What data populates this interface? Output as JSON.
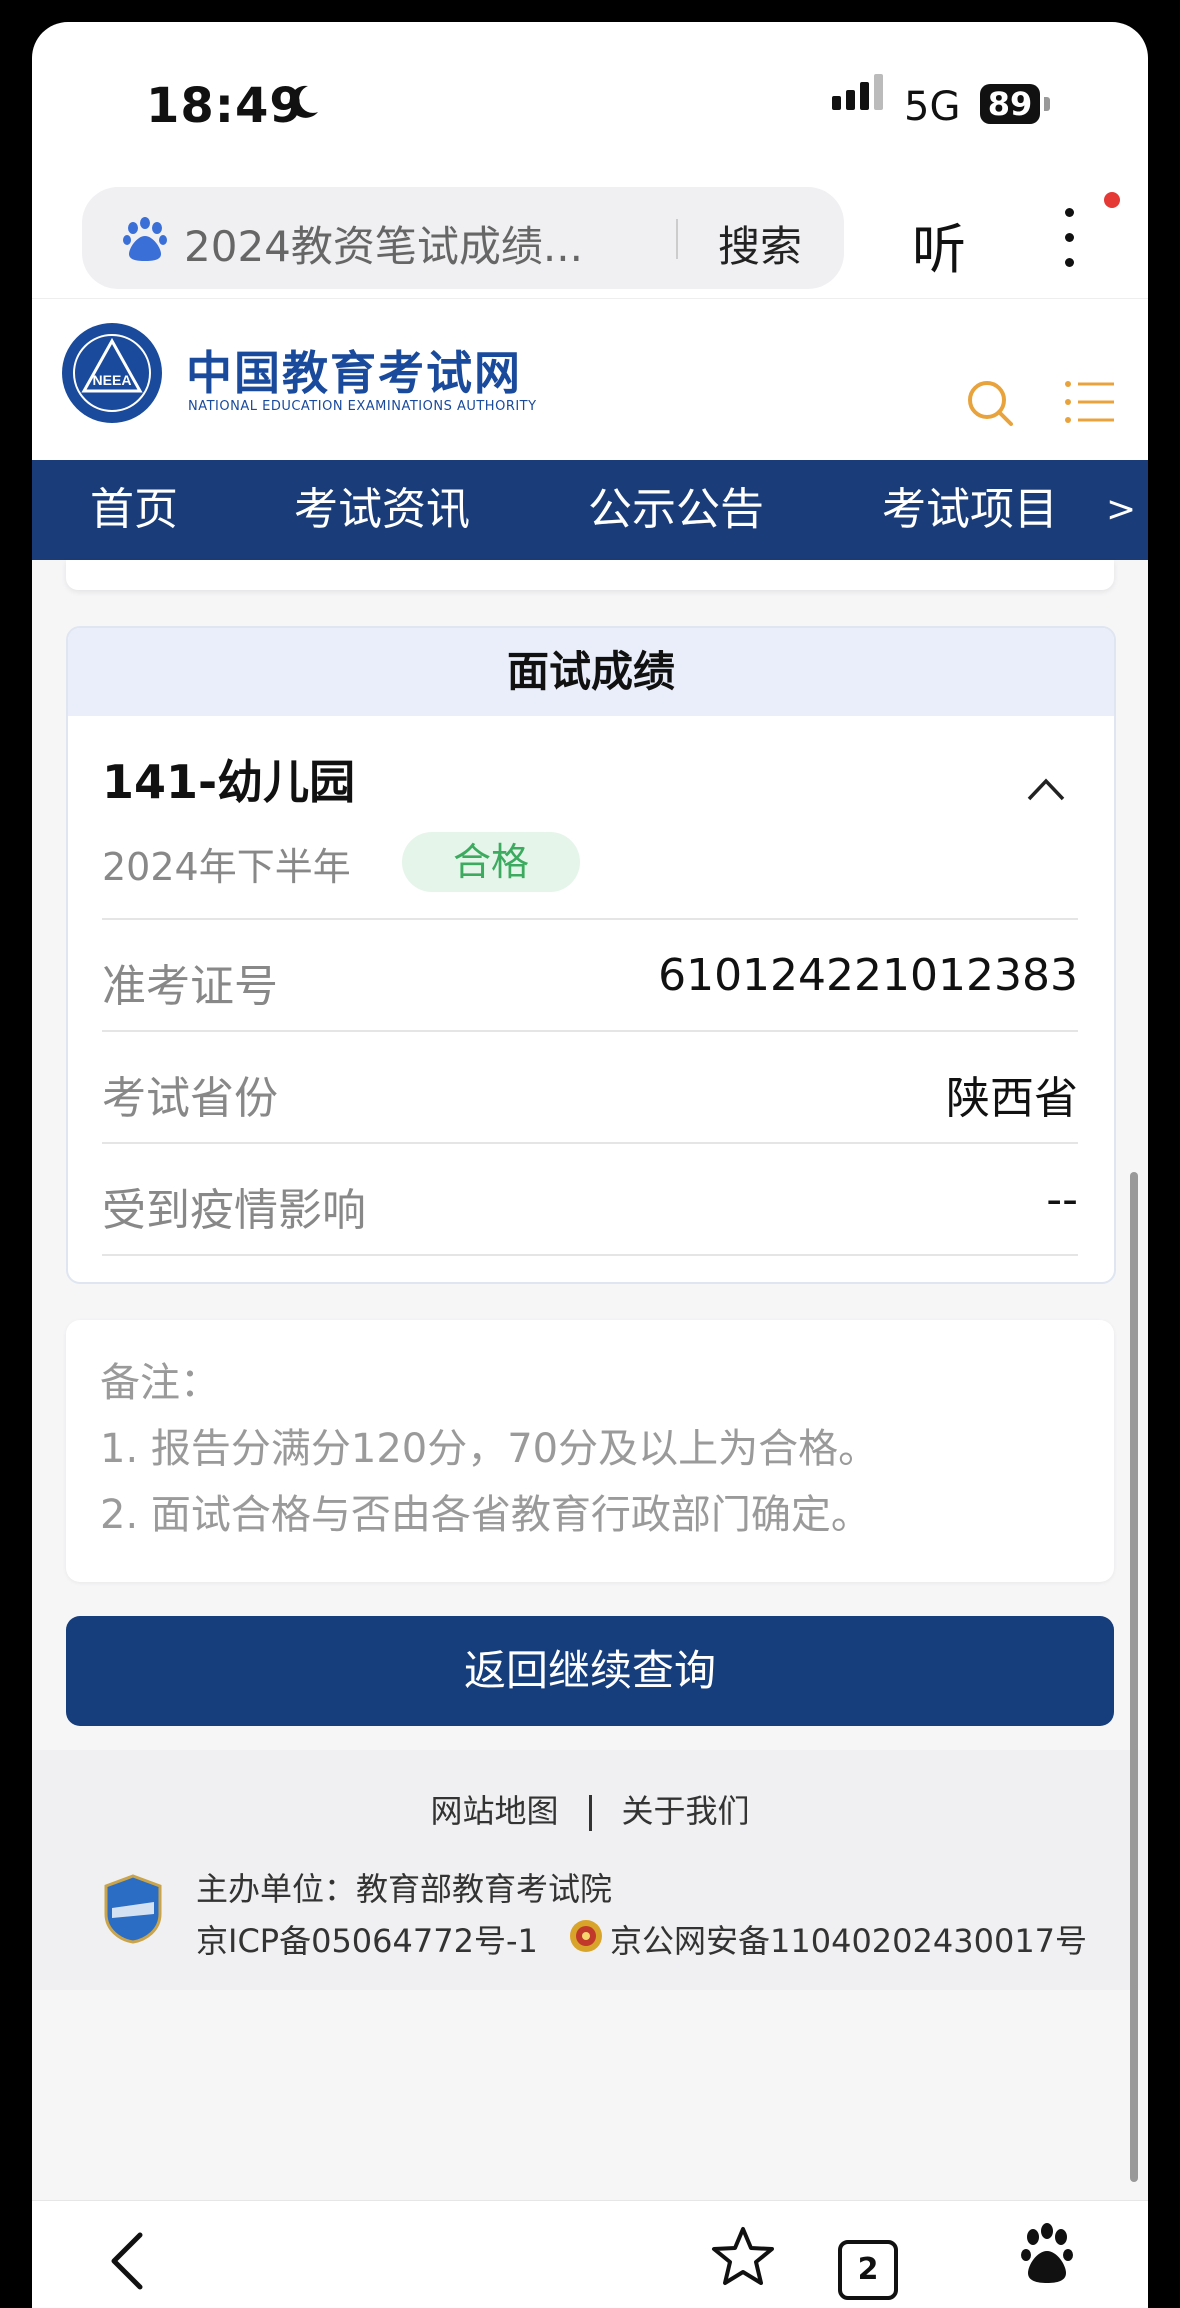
{
  "status_bar": {
    "time": "18:49",
    "network": "5G",
    "battery": "89"
  },
  "browser": {
    "search_text": "2024教资笔试成绩...",
    "search_button": "搜索",
    "listen_button": "听"
  },
  "site": {
    "title": "中国教育考试网",
    "subtitle": "NATIONAL EDUCATION EXAMINATIONS AUTHORITY",
    "logo_text": "NEEA"
  },
  "nav": {
    "items": [
      "首页",
      "考试资讯",
      "公示公告",
      "考试项目"
    ],
    "more": ">"
  },
  "result_card": {
    "title": "面试成绩",
    "subject": "141-幼儿园",
    "semester": "2024年下半年",
    "status": "合格",
    "rows": [
      {
        "label": "准考证号",
        "value": "610124221012383"
      },
      {
        "label": "考试省份",
        "value": "陕西省"
      },
      {
        "label": "受到疫情影响",
        "value": "--"
      }
    ]
  },
  "notes": {
    "title": "备注：",
    "lines": [
      "1. 报告分满分120分，70分及以上为合格。",
      "2. 面试合格与否由各省教育行政部门确定。"
    ]
  },
  "back_button": "返回继续查询",
  "footer": {
    "links": [
      "网站地图",
      "关于我们"
    ],
    "host": "主办单位：教育部教育考试院",
    "icp": "京ICP备05064772号-1",
    "police": "京公网安备11040202430017号"
  },
  "toolbar": {
    "tab_count": "2"
  },
  "colors": {
    "nav_bg": "#1a3d7a",
    "button_bg": "#163d7c",
    "pass_green": "#3dab5f",
    "accent_orange": "#e8a33d"
  }
}
